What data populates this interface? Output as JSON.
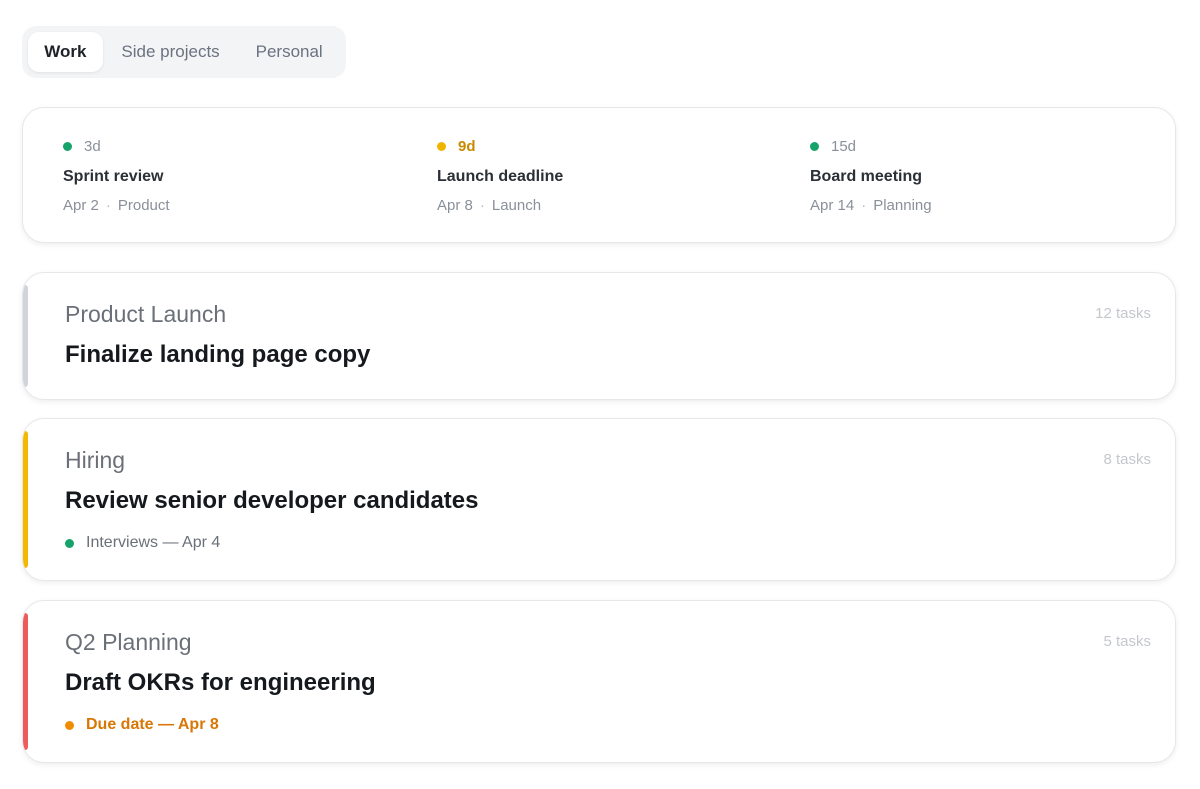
{
  "tabs": [
    {
      "label": "Work",
      "active": true
    },
    {
      "label": "Side projects",
      "active": false
    },
    {
      "label": "Personal",
      "active": false
    }
  ],
  "deadlines": [
    {
      "days": "3d",
      "title": "Sprint review",
      "date": "Apr 2",
      "category": "Product",
      "color": "#16a36b",
      "text_color": "#8a9099"
    },
    {
      "days": "9d",
      "title": "Launch deadline",
      "date": "Apr 8",
      "category": "Launch",
      "color": "#f0b400",
      "text_color": "#c98a00"
    },
    {
      "days": "15d",
      "title": "Board meeting",
      "date": "Apr 14",
      "category": "Planning",
      "color": "#16a36b",
      "text_color": "#8a9099"
    }
  ],
  "projects": [
    {
      "name": "Product Launch",
      "task": "Finalize landing page copy",
      "count": "12 tasks",
      "accent": "#d1d5db",
      "status": null
    },
    {
      "name": "Hiring",
      "task": "Review senior developer candidates",
      "count": "8 tasks",
      "accent": "#f5b800",
      "status": {
        "text": "Interviews — Apr 4",
        "dot_color": "#16a36b",
        "text_color": "#6b7078"
      }
    },
    {
      "name": "Q2 Planning",
      "task": "Draft OKRs for engineering",
      "count": "5 tasks",
      "accent": "#ef5b5b",
      "status": {
        "text": "Due date — Apr 8",
        "dot_color": "#f08c00",
        "text_color": "#d97706"
      }
    }
  ],
  "separator": "·"
}
